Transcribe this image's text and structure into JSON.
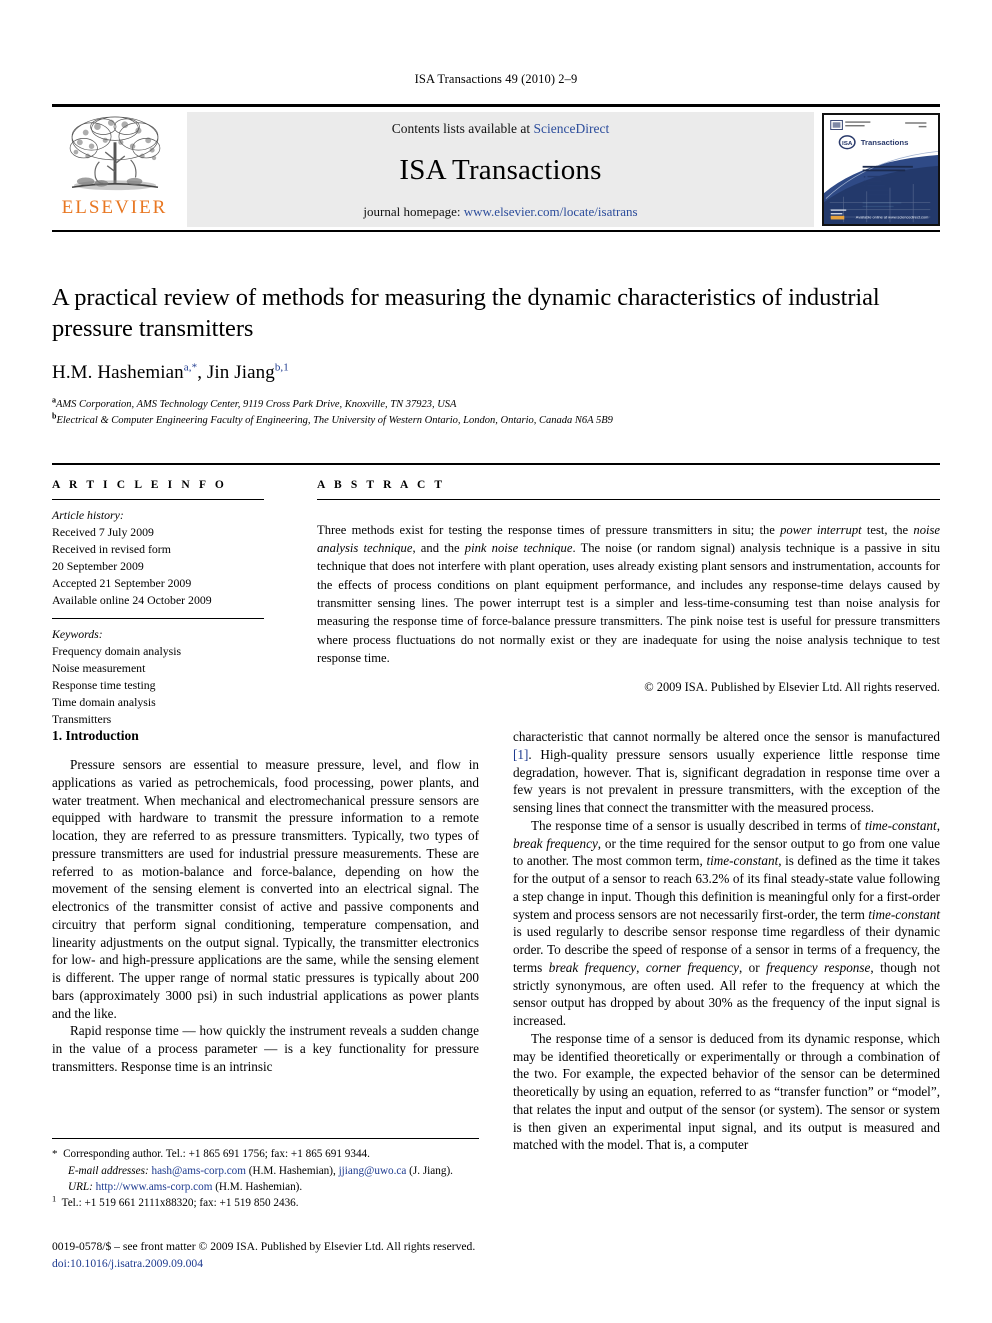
{
  "running_head": "ISA Transactions 49 (2010) 2–9",
  "masthead": {
    "publisher_name": "ELSEVIER",
    "contents_prefix": "Contents lists available at ",
    "contents_link": "ScienceDirect",
    "journal_title": "ISA Transactions",
    "homepage_prefix": "journal homepage: ",
    "homepage_url": "www.elsevier.com/locate/isatrans",
    "cover": {
      "brand": "ISA",
      "brand_title": "Transactions",
      "subtitle": "The Science and Engineering of Measurement and Automation",
      "bullets": [
        "Automation",
        "Control",
        "Instrumentation",
        "System Integration",
        "Asset Management"
      ],
      "footer_note": "Available online at www.sciencedirect.com"
    }
  },
  "article": {
    "title": "A practical review of methods for measuring the dynamic characteristics of industrial pressure transmitters",
    "authors_plain": "H.M. Hashemian",
    "author1": "H.M. Hashemian",
    "author1_sup": "a,*",
    "author2": "Jin Jiang",
    "author2_sup": "b,1",
    "affiliation_a_mark": "a",
    "affiliation_a": "AMS Corporation, AMS Technology Center, 9119 Cross Park Drive, Knoxville, TN 37923, USA",
    "affiliation_b_mark": "b",
    "affiliation_b": "Electrical & Computer Engineering Faculty of Engineering, The University of Western Ontario, London, Ontario, Canada N6A 5B9"
  },
  "info": {
    "heading": "A R T I C L E    I N F O",
    "history_title": "Article history:",
    "history": [
      "Received 7 July 2009",
      "Received in revised form",
      "20 September 2009",
      "Accepted 21 September 2009",
      "Available online 24 October 2009"
    ],
    "keywords_title": "Keywords:",
    "keywords": [
      "Frequency domain analysis",
      "Noise measurement",
      "Response time testing",
      "Time domain analysis",
      "Transmitters"
    ]
  },
  "abstract": {
    "heading": "A B S T R A C T",
    "p1_a": "Three methods exist for testing the response times of pressure transmitters in situ; the ",
    "p1_i1": "power interrupt",
    "p1_b": " test, the ",
    "p1_i2": "noise analysis technique",
    "p1_c": ", and the ",
    "p1_i3": "pink noise technique",
    "p1_d": ". The noise (or random signal) analysis technique is a passive in situ technique that does not interfere with plant operation, uses already existing plant sensors and instrumentation, accounts for the effects of process conditions on plant equipment performance, and includes any response-time delays caused by transmitter sensing lines. The power interrupt test is a simpler and less-time-consuming test than noise analysis for measuring the response time of force-balance pressure transmitters. The pink noise test is useful for pressure transmitters where process fluctuations do not normally exist or they are inadequate for using the noise analysis technique to test response time.",
    "copyright": "© 2009 ISA. Published by Elsevier Ltd. All rights reserved."
  },
  "body": {
    "section_number_title": "1.  Introduction",
    "left_p1": "Pressure sensors are essential to measure pressure, level, and flow in applications as varied as petrochemicals, food processing, power plants, and water treatment. When mechanical and electromechanical pressure sensors are equipped with hardware to transmit the pressure information to a remote location, they are referred to as pressure transmitters. Typically, two types of pressure transmitters are used for industrial pressure measurements. These are referred to as motion-balance and force-balance, depending on how the movement of the sensing element is converted into an electrical signal. The electronics of the transmitter consist of active and passive components and circuitry that perform signal conditioning, temperature compensation, and linearity adjustments on the output signal. Typically, the transmitter electronics for low- and high-pressure applications are the same, while the sensing element is different. The upper range of normal static pressures is typically about 200 bars (approximately 3000 psi) in such industrial applications as power plants and the like.",
    "left_p2": "Rapid response time — how quickly the instrument reveals a sudden change in the value of a process parameter — is a key functionality for pressure transmitters. Response time is an intrinsic",
    "right_p1_a": "characteristic that cannot normally be altered once the sensor is manufactured ",
    "right_p1_ref": "[1]",
    "right_p1_b": ". High-quality pressure sensors usually experience little response time degradation, however. That is, significant degradation in response time over a few years is not prevalent in pressure transmitters, with the exception of the sensing lines that connect the transmitter with the measured process.",
    "right_p2_a": "The response time of a sensor is usually described in terms of ",
    "right_p2_i1": "time-constant",
    "right_p2_b": ", ",
    "right_p2_i2": "break frequency",
    "right_p2_c": ", or the time required for the sensor output to go from one value to another. The most common term, ",
    "right_p2_i3": "time-constant",
    "right_p2_d": ", is defined as the time it takes for the output of a sensor to reach 63.2% of its final steady-state value following a step change in input. Though this definition is meaningful only for a first-order system and process sensors are not necessarily first-order, the term ",
    "right_p2_i4": "time-constant",
    "right_p2_e": " is used regularly to describe sensor response time regardless of their dynamic order. To describe the speed of response of a sensor in terms of a frequency, the terms ",
    "right_p2_i5": "break frequency",
    "right_p2_f": ", ",
    "right_p2_i6": "corner frequency",
    "right_p2_g": ", or ",
    "right_p2_i7": "frequency response",
    "right_p2_h": ", though not strictly synonymous, are often used. All refer to the frequency at which the sensor output has dropped by about 30% as the frequency of the input signal is increased.",
    "right_p3": "The response time of a sensor is deduced from its dynamic response, which may be identified theoretically or experimentally or through a combination of the two. For example, the expected behavior of the sensor can be determined theoretically by using an equation, referred to as “transfer function” or “model”, that relates the input and output of the sensor (or system). The sensor or system is then given an experimental input signal, and its output is measured and matched with the model. That is, a computer"
  },
  "footnotes": {
    "star_mark": "*",
    "star_text": "Corresponding author. Tel.: +1 865 691 1756; fax: +1 865 691 9344.",
    "email_label": "E-mail addresses:",
    "email1": "hash@ams-corp.com",
    "email1_owner": " (H.M. Hashemian), ",
    "email2": "jjiang@uwo.ca",
    "email2_owner": " (J. Jiang).",
    "url_label": "URL:",
    "url_value": "http://www.ams-corp.com",
    "url_owner": " (H.M. Hashemian).",
    "one_mark": "1",
    "one_text": "Tel.: +1 519 661 2111x88320; fax: +1 519 850 2436."
  },
  "footer": {
    "issn_line": "0019-0578/$ – see front matter © 2009 ISA. Published by Elsevier Ltd. All rights reserved.",
    "doi": "doi:10.1016/j.isatra.2009.09.004"
  },
  "colors": {
    "elsevier_orange": "#E87722",
    "link_blue": "#1d3a8f",
    "sciencedirect_blue": "#2b4c9b",
    "banner_grey": "#ebebeb"
  }
}
